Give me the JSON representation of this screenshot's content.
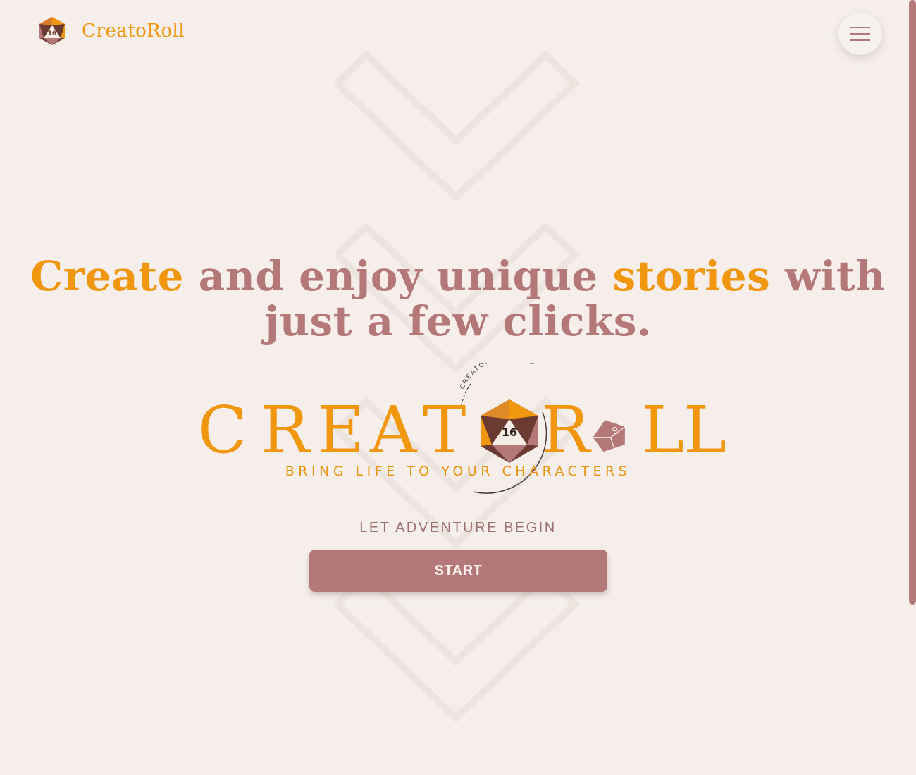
{
  "navbar": {
    "brand_name": "CreatoRoll",
    "menu_icon": "hamburger-menu-icon"
  },
  "hero": {
    "headline_parts": [
      "Create",
      " and enjoy unique ",
      "stories",
      " with just a few clicks."
    ],
    "logo": {
      "wordmark_letters": [
        "C",
        "R",
        "E",
        "A",
        "T",
        "R",
        "L",
        "L"
      ],
      "arc_text": "CREATOROLL · DND",
      "subtitle": "BRING LIFE TO YOUR CHARACTERS",
      "d20_number": "16",
      "d10_number": "9"
    },
    "tagline": "LET ADVENTURE BEGIN",
    "start_label": "START"
  },
  "colors": {
    "background": "#f5eeea",
    "accent": "#f0960f",
    "rose": "#b47878",
    "dark_brown": "#6b3a30"
  }
}
